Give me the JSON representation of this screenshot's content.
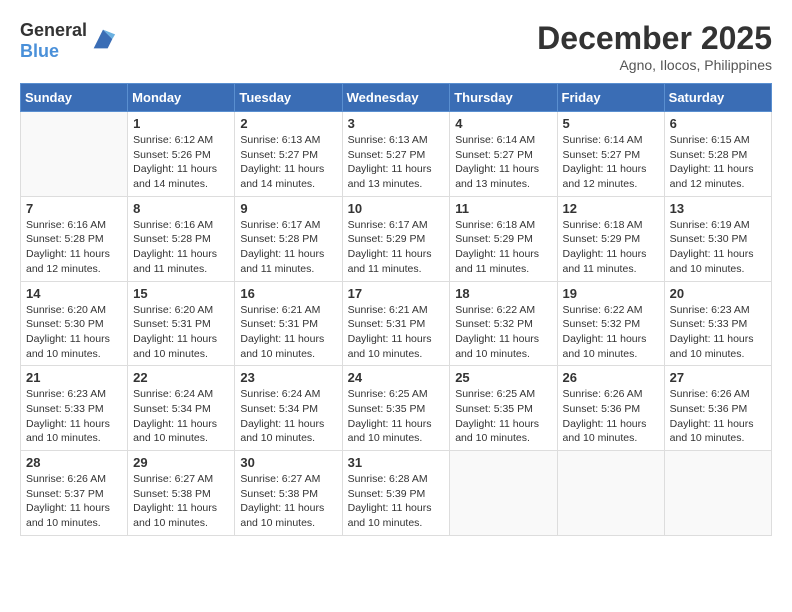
{
  "header": {
    "logo": {
      "text_general": "General",
      "text_blue": "Blue"
    },
    "month_year": "December 2025",
    "location": "Agno, Ilocos, Philippines"
  },
  "weekdays": [
    "Sunday",
    "Monday",
    "Tuesday",
    "Wednesday",
    "Thursday",
    "Friday",
    "Saturday"
  ],
  "weeks": [
    [
      {
        "day": "",
        "empty": true
      },
      {
        "day": "1",
        "sunrise": "6:12 AM",
        "sunset": "5:26 PM",
        "daylight": "11 hours and 14 minutes."
      },
      {
        "day": "2",
        "sunrise": "6:13 AM",
        "sunset": "5:27 PM",
        "daylight": "11 hours and 14 minutes."
      },
      {
        "day": "3",
        "sunrise": "6:13 AM",
        "sunset": "5:27 PM",
        "daylight": "11 hours and 13 minutes."
      },
      {
        "day": "4",
        "sunrise": "6:14 AM",
        "sunset": "5:27 PM",
        "daylight": "11 hours and 13 minutes."
      },
      {
        "day": "5",
        "sunrise": "6:14 AM",
        "sunset": "5:27 PM",
        "daylight": "11 hours and 12 minutes."
      },
      {
        "day": "6",
        "sunrise": "6:15 AM",
        "sunset": "5:28 PM",
        "daylight": "11 hours and 12 minutes."
      }
    ],
    [
      {
        "day": "7",
        "sunrise": "6:16 AM",
        "sunset": "5:28 PM",
        "daylight": "11 hours and 12 minutes."
      },
      {
        "day": "8",
        "sunrise": "6:16 AM",
        "sunset": "5:28 PM",
        "daylight": "11 hours and 11 minutes."
      },
      {
        "day": "9",
        "sunrise": "6:17 AM",
        "sunset": "5:28 PM",
        "daylight": "11 hours and 11 minutes."
      },
      {
        "day": "10",
        "sunrise": "6:17 AM",
        "sunset": "5:29 PM",
        "daylight": "11 hours and 11 minutes."
      },
      {
        "day": "11",
        "sunrise": "6:18 AM",
        "sunset": "5:29 PM",
        "daylight": "11 hours and 11 minutes."
      },
      {
        "day": "12",
        "sunrise": "6:18 AM",
        "sunset": "5:29 PM",
        "daylight": "11 hours and 11 minutes."
      },
      {
        "day": "13",
        "sunrise": "6:19 AM",
        "sunset": "5:30 PM",
        "daylight": "11 hours and 10 minutes."
      }
    ],
    [
      {
        "day": "14",
        "sunrise": "6:20 AM",
        "sunset": "5:30 PM",
        "daylight": "11 hours and 10 minutes."
      },
      {
        "day": "15",
        "sunrise": "6:20 AM",
        "sunset": "5:31 PM",
        "daylight": "11 hours and 10 minutes."
      },
      {
        "day": "16",
        "sunrise": "6:21 AM",
        "sunset": "5:31 PM",
        "daylight": "11 hours and 10 minutes."
      },
      {
        "day": "17",
        "sunrise": "6:21 AM",
        "sunset": "5:31 PM",
        "daylight": "11 hours and 10 minutes."
      },
      {
        "day": "18",
        "sunrise": "6:22 AM",
        "sunset": "5:32 PM",
        "daylight": "11 hours and 10 minutes."
      },
      {
        "day": "19",
        "sunrise": "6:22 AM",
        "sunset": "5:32 PM",
        "daylight": "11 hours and 10 minutes."
      },
      {
        "day": "20",
        "sunrise": "6:23 AM",
        "sunset": "5:33 PM",
        "daylight": "11 hours and 10 minutes."
      }
    ],
    [
      {
        "day": "21",
        "sunrise": "6:23 AM",
        "sunset": "5:33 PM",
        "daylight": "11 hours and 10 minutes."
      },
      {
        "day": "22",
        "sunrise": "6:24 AM",
        "sunset": "5:34 PM",
        "daylight": "11 hours and 10 minutes."
      },
      {
        "day": "23",
        "sunrise": "6:24 AM",
        "sunset": "5:34 PM",
        "daylight": "11 hours and 10 minutes."
      },
      {
        "day": "24",
        "sunrise": "6:25 AM",
        "sunset": "5:35 PM",
        "daylight": "11 hours and 10 minutes."
      },
      {
        "day": "25",
        "sunrise": "6:25 AM",
        "sunset": "5:35 PM",
        "daylight": "11 hours and 10 minutes."
      },
      {
        "day": "26",
        "sunrise": "6:26 AM",
        "sunset": "5:36 PM",
        "daylight": "11 hours and 10 minutes."
      },
      {
        "day": "27",
        "sunrise": "6:26 AM",
        "sunset": "5:36 PM",
        "daylight": "11 hours and 10 minutes."
      }
    ],
    [
      {
        "day": "28",
        "sunrise": "6:26 AM",
        "sunset": "5:37 PM",
        "daylight": "11 hours and 10 minutes."
      },
      {
        "day": "29",
        "sunrise": "6:27 AM",
        "sunset": "5:38 PM",
        "daylight": "11 hours and 10 minutes."
      },
      {
        "day": "30",
        "sunrise": "6:27 AM",
        "sunset": "5:38 PM",
        "daylight": "11 hours and 10 minutes."
      },
      {
        "day": "31",
        "sunrise": "6:28 AM",
        "sunset": "5:39 PM",
        "daylight": "11 hours and 10 minutes."
      },
      {
        "day": "",
        "empty": true
      },
      {
        "day": "",
        "empty": true
      },
      {
        "day": "",
        "empty": true
      }
    ]
  ],
  "labels": {
    "sunrise_prefix": "Sunrise: ",
    "sunset_prefix": "Sunset: ",
    "daylight_label": "Daylight: "
  }
}
